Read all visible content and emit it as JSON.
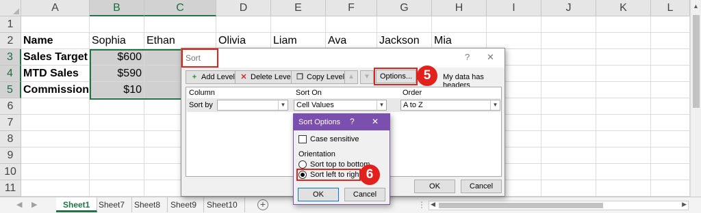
{
  "sheet": {
    "columns": [
      "A",
      "B",
      "C",
      "D",
      "E",
      "F",
      "G",
      "H",
      "I",
      "J",
      "K",
      "L"
    ],
    "rows": [
      "1",
      "2",
      "3",
      "4",
      "5",
      "6",
      "7",
      "8",
      "9",
      "10",
      "11"
    ],
    "cells": {
      "A2": "Name",
      "B2": "Sophia",
      "C2": "Ethan",
      "D2": "Olivia",
      "E2": "Liam",
      "F2": "Ava",
      "G2": "Jackson",
      "H2": "Mia",
      "A3": "Sales Target",
      "B3": "$600",
      "A4": "MTD Sales",
      "B4": "$590",
      "A5": "Commission",
      "B5": "$10"
    },
    "tabs": [
      "Sheet1",
      "Sheet7",
      "Sheet8",
      "Sheet9",
      "Sheet10"
    ],
    "active_tab": "Sheet1",
    "add_sheet_symbol": "+"
  },
  "sort_dialog": {
    "title": "Sort",
    "help_symbol": "?",
    "close_symbol": "✕",
    "add_level": "Add Level",
    "delete_level": "Delete Level",
    "copy_level": "Copy Level",
    "move_up": "▲",
    "move_down": "▼",
    "options": "Options...",
    "headers_checkbox": "My data has headers",
    "col_header": "Column",
    "sort_on_header": "Sort On",
    "order_header": "Order",
    "sort_by_label": "Sort by",
    "sort_by_value": "",
    "sort_on_value": "Cell Values",
    "order_value": "A to Z",
    "ok": "OK",
    "cancel": "Cancel"
  },
  "options_dialog": {
    "title": "Sort Options",
    "help_symbol": "?",
    "close_symbol": "✕",
    "case_sensitive": "Case sensitive",
    "orientation_label": "Orientation",
    "top_to_bottom": "Sort top to bottom",
    "left_to_right": "Sort left to right",
    "selected_orientation": "left_to_right",
    "ok": "OK",
    "cancel": "Cancel"
  },
  "annotations": {
    "step5": "5",
    "step6": "6"
  },
  "colors": {
    "excel_green": "#217346",
    "highlight_red": "#e2211c",
    "dialog_purple": "#7b4fae"
  }
}
